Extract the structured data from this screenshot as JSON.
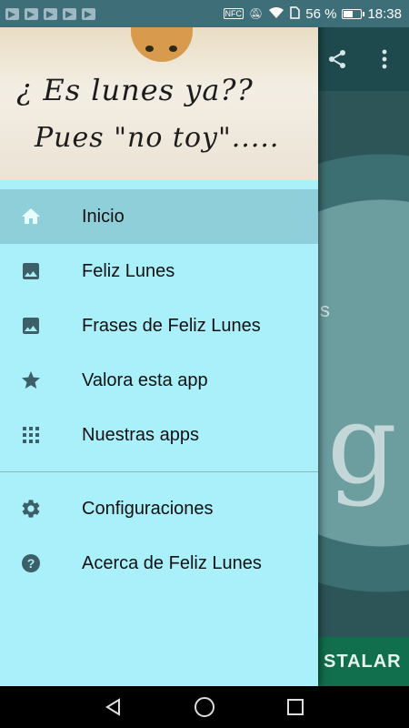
{
  "status_bar": {
    "nfc": "NFC",
    "battery_percent": "56 %",
    "battery_level": 0.56,
    "time": "18:38"
  },
  "header_image": {
    "line1": "¿ Es lunes ya??",
    "line2": "Pues \"no toy\"....."
  },
  "menu": {
    "items": [
      {
        "label": "Inicio",
        "icon": "home-icon"
      },
      {
        "label": "Feliz Lunes",
        "icon": "image-icon"
      },
      {
        "label": "Frases de Feliz Lunes",
        "icon": "image-icon"
      },
      {
        "label": "Valora esta app",
        "icon": "star-icon"
      },
      {
        "label": "Nuestras apps",
        "icon": "apps-grid-icon"
      }
    ],
    "secondary": [
      {
        "label": "Configuraciones",
        "icon": "settings-gear-icon"
      },
      {
        "label": "Acerca de Feliz Lunes",
        "icon": "help-icon"
      }
    ]
  },
  "background_app": {
    "install_label": "STALAR",
    "letter": "g",
    "side_text": "s"
  },
  "colors": {
    "drawer_bg": "#aaf0fb",
    "selected_bg": "#8fcfd9",
    "icon_color": "#3d5f68",
    "install_bg": "#116f4e"
  }
}
